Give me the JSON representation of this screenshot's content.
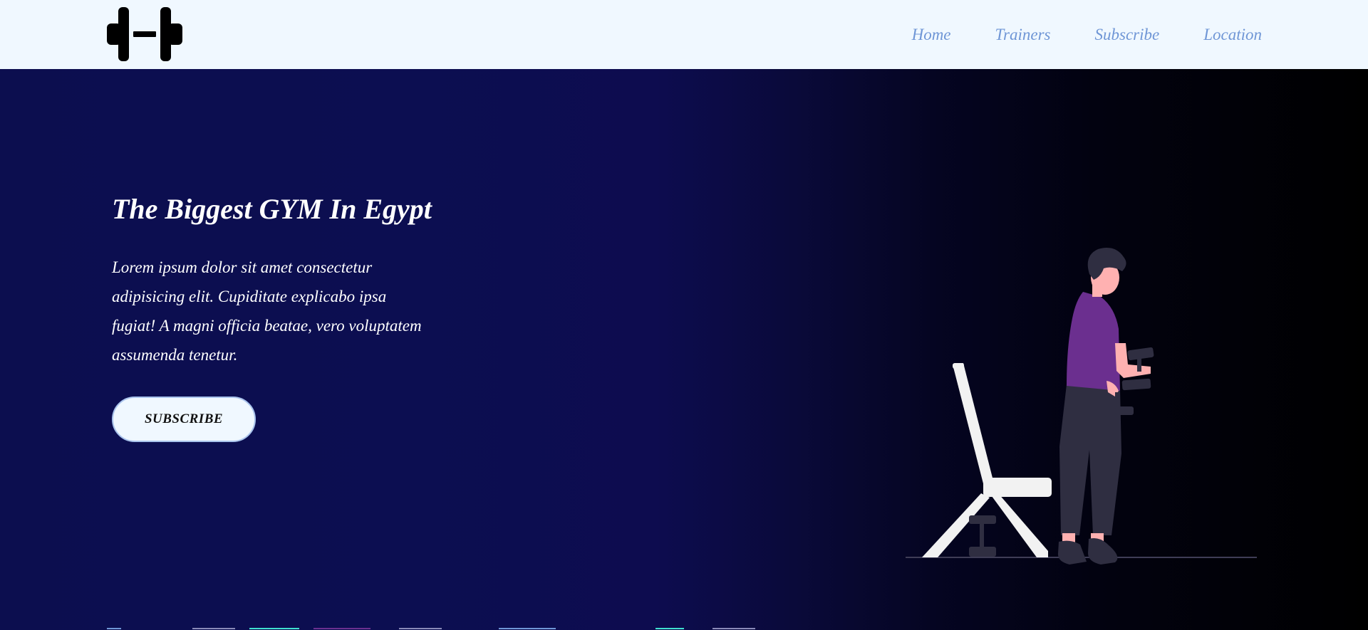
{
  "navbar": {
    "logo_icon": "dumbbell-icon",
    "links": [
      {
        "label": "Home"
      },
      {
        "label": "Trainers"
      },
      {
        "label": "Subscribe"
      },
      {
        "label": "Location"
      }
    ]
  },
  "hero": {
    "title": "The Biggest GYM In Egypt",
    "description": "Lorem ipsum dolor sit amet consectetur adipisicing elit. Cupiditate explicabo ipsa fugiat! A magni officia beatae, vero voluptatem assumenda tenetur.",
    "button_label": "SUBSCRIBE",
    "illustration_icon": "person-lifting-dumbbells-illustration"
  },
  "colors": {
    "navbar_bg": "#f0f8ff",
    "nav_link": "#6f96d6",
    "hero_bg_start": "#0c0e51",
    "hero_bg_end": "#000000",
    "shirt": "#6b2f8f",
    "skin": "#ffb1b1",
    "dark": "#2f2e41",
    "bench": "#f2f2f2"
  }
}
